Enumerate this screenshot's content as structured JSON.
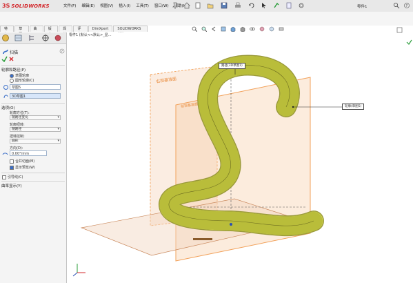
{
  "app": {
    "brand_ds": "3S",
    "brand_name": "SOLIDWORKS",
    "user": "零件1"
  },
  "menu": [
    "文件(F)",
    "编辑(E)",
    "视图(V)",
    "插入(I)",
    "工具(T)",
    "窗口(W)",
    "帮助(H)"
  ],
  "tabs": [
    {
      "label": "特征",
      "active": false
    },
    {
      "label": "草图",
      "active": false
    },
    {
      "label": "曲面",
      "active": false
    },
    {
      "label": "钣金",
      "active": false
    },
    {
      "label": "焊件",
      "active": false
    },
    {
      "label": "评估",
      "active": false
    },
    {
      "label": "DimXpert",
      "active": false
    },
    {
      "label": "SOLIDWORKS 插件",
      "active": false
    }
  ],
  "breadcrumb": "零件1 (默认<<默认>_显...",
  "property_manager": {
    "title": "扫描",
    "profile_section": "轮廓和路径(P)",
    "option_sketch_profile": "草图轮廓",
    "option_circle_profile": "圆形轮廓(C)",
    "profile_field": "草图5",
    "path_field": "3D草图1",
    "options_section": "选项(O)",
    "orientation_label": "轮廓方位(T):",
    "orientation_value": "随路径变化",
    "twist_label": "轮廓扭转:",
    "twist_value": "无",
    "twist_label2": "扭转控制:",
    "twist_value2": "随路径",
    "twist_value3": "圆形",
    "direction_label": "方向(D):",
    "direction_value": "0.00°/mm",
    "merge_smooth": "合并切面(M)",
    "show_preview": "显示预览(W)",
    "guide_section": "引导线(C)",
    "curvature_section": "曲率显示(Y)"
  },
  "viewport": {
    "callout_path": "路径(3D草图1)",
    "callout_profile": "轮廓(草图5)",
    "right_plane": "右视基准面",
    "front_plane": "前视基准面"
  },
  "colors": {
    "brand": "#d3272b",
    "plane": "#f2a15a",
    "sweep": "#d9dc5a",
    "accent": "#3a6ec8"
  }
}
